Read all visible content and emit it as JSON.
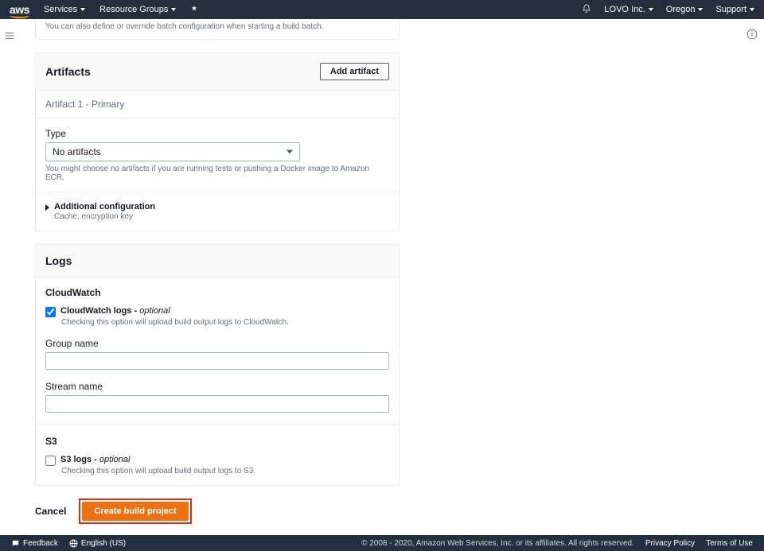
{
  "nav": {
    "logo": "aws",
    "services": "Services",
    "resource_groups": "Resource Groups",
    "account": "LOVO Inc.",
    "region": "Oregon",
    "support": "Support"
  },
  "batch_desc": "You can also define or override batch configuration when starting a build batch.",
  "artifacts": {
    "title": "Artifacts",
    "add_btn": "Add artifact",
    "subtitle": "Artifact 1 - Primary",
    "type_label": "Type",
    "type_value": "No artifacts",
    "type_help": "You might choose no artifacts if you are running tests or pushing a Docker image to Amazon ECR.",
    "addl_title": "Additional configuration",
    "addl_sub": "Cache, encryption key"
  },
  "logs": {
    "title": "Logs",
    "cw_section": "CloudWatch",
    "cw_label": "CloudWatch logs - ",
    "cw_opt": "optional",
    "cw_desc": "Checking this option will upload build output logs to CloudWatch.",
    "group_label": "Group name",
    "stream_label": "Stream name",
    "s3_section": "S3",
    "s3_label": "S3 logs - ",
    "s3_opt": "optional",
    "s3_desc": "Checking this option will upload build output logs to S3."
  },
  "actions": {
    "cancel": "Cancel",
    "create": "Create build project"
  },
  "footer": {
    "feedback": "Feedback",
    "language": "English (US)",
    "copyright": "© 2008 - 2020, Amazon Web Services, Inc. or its affiliates. All rights reserved.",
    "privacy": "Privacy Policy",
    "terms": "Terms of Use"
  }
}
